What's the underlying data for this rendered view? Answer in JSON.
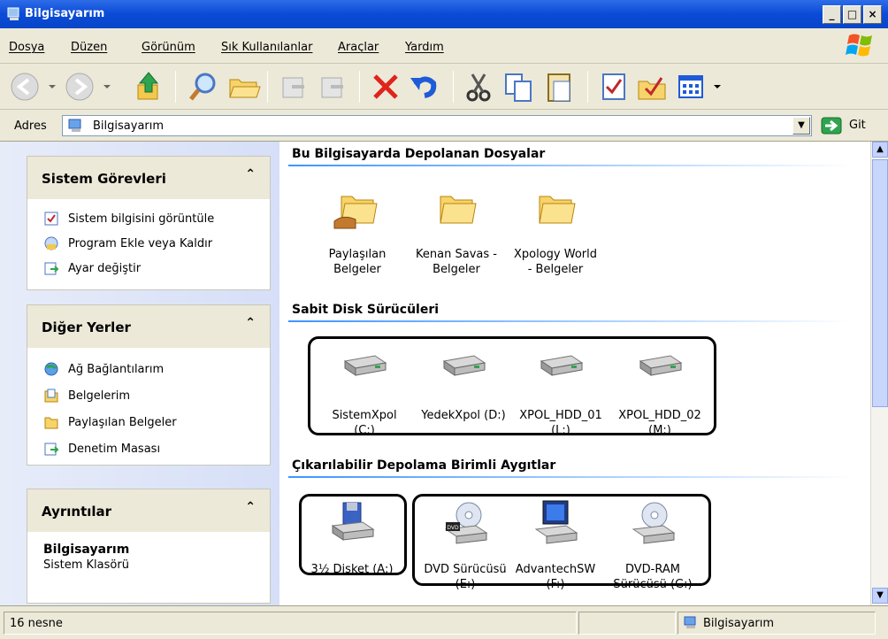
{
  "window": {
    "title": "Bilgisayarım"
  },
  "menu": [
    "Dosya",
    "Düzen",
    "Görünüm",
    "Sık Kullanılanlar",
    "Araçlar",
    "Yardım"
  ],
  "address": {
    "label": "Adres",
    "value": "Bilgisayarım",
    "go": "Git"
  },
  "sidebar": {
    "system_tasks": {
      "title": "Sistem Görevleri",
      "items": [
        "Sistem bilgisini görüntüle",
        "Program Ekle veya Kaldır",
        "Ayar değiştir"
      ]
    },
    "other_places": {
      "title": "Diğer Yerler",
      "items": [
        "Ağ Bağlantılarım",
        "Belgelerim",
        "Paylaşılan Belgeler",
        "Denetim Masası"
      ]
    },
    "details": {
      "title": "Ayrıntılar",
      "name": "Bilgisayarım",
      "type": "Sistem Klasörü"
    }
  },
  "sections": {
    "files": {
      "title": "Bu Bilgisayarda Depolanan Dosyalar",
      "items": [
        {
          "line1": "Paylaşılan",
          "line2": "Belgeler",
          "icon": "shared-folder-icon"
        },
        {
          "line1": "Kenan Savas -",
          "line2": "Belgeler",
          "icon": "folder-icon"
        },
        {
          "line1": "Xpology World",
          "line2": "- Belgeler",
          "icon": "folder-icon"
        }
      ]
    },
    "hdd": {
      "title": "Sabit Disk Sürücüleri",
      "items": [
        {
          "line1": "SistemXpol",
          "line2": "(C:)",
          "icon": "hard-drive-icon"
        },
        {
          "line1": "YedekXpol (D:)",
          "line2": "",
          "icon": "hard-drive-icon"
        },
        {
          "line1": "XPOL_HDD_01",
          "line2": "(L:)",
          "icon": "hard-drive-icon"
        },
        {
          "line1": "XPOL_HDD_02",
          "line2": "(M:)",
          "icon": "hard-drive-icon"
        }
      ]
    },
    "removable": {
      "title": "Çıkarılabilir Depolama Birimli Aygıtlar",
      "items": [
        {
          "line1": "3½ Disket (A:)",
          "line2": "",
          "icon": "floppy-drive-icon"
        },
        {
          "line1": "DVD Sürücüsü",
          "line2": "(E:)",
          "icon": "dvd-drive-icon"
        },
        {
          "line1": "AdvantechSW",
          "line2": "(F:)",
          "icon": "computer-drive-icon"
        },
        {
          "line1": "DVD-RAM",
          "line2": "Sürücüsü (G:)",
          "icon": "dvd-ram-drive-icon"
        }
      ]
    }
  },
  "status": {
    "count": "16 nesne",
    "location": "Bilgisayarım"
  }
}
